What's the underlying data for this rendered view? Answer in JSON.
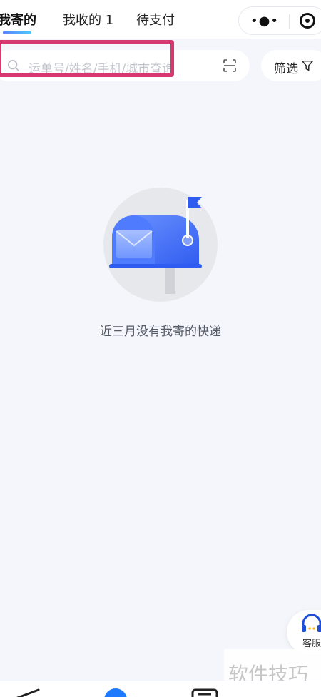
{
  "tabs": [
    {
      "label": "我寄的",
      "active": true
    },
    {
      "label": "我收的 1",
      "active": false
    },
    {
      "label": "待支付",
      "active": false
    }
  ],
  "capsule": {
    "more_icon": "more-dots-icon",
    "close_icon": "target-circle-icon"
  },
  "search": {
    "placeholder": "运单号/姓名/手机/城市查询",
    "search_icon": "search-icon",
    "scan_icon": "scan-icon"
  },
  "filter": {
    "label": "筛选",
    "icon": "funnel-icon"
  },
  "empty_state": {
    "illustration": "mailbox-icon",
    "message": "近三月没有我寄的快递"
  },
  "service": {
    "label": "客服",
    "icon": "headset-icon"
  },
  "watermark": {
    "text": "软件技巧"
  },
  "colors": {
    "accent": "#4a7cff",
    "highlight_border": "#d83870",
    "background": "#f4f6fb"
  }
}
